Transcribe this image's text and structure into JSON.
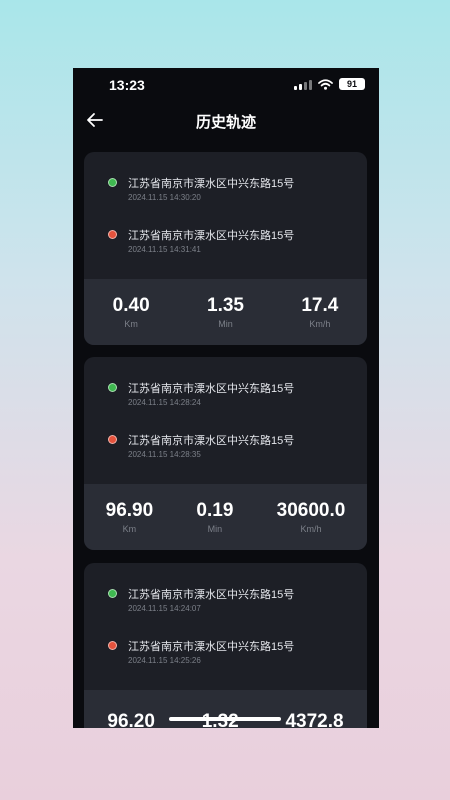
{
  "status_bar": {
    "time": "13:23",
    "battery": "91"
  },
  "header": {
    "title": "历史轨迹"
  },
  "icons": {
    "back": "arrow-left-icon",
    "signal": "cellular-signal-icon",
    "wifi": "wifi-icon",
    "battery": "battery-icon"
  },
  "colors": {
    "start_dot": "#3fb950",
    "end_dot": "#e5533d",
    "card_bg": "#1d1f26",
    "stats_bg": "#2a2d36"
  },
  "trips": [
    {
      "start": {
        "address": "江苏省南京市溧水区中兴东路15号",
        "time": "2024.11.15 14:30:20"
      },
      "end": {
        "address": "江苏省南京市溧水区中兴东路15号",
        "time": "2024.11.15 14:31:41"
      },
      "stats": [
        {
          "value": "0.40",
          "unit": "Km"
        },
        {
          "value": "1.35",
          "unit": "Min"
        },
        {
          "value": "17.4",
          "unit": "Km/h"
        }
      ]
    },
    {
      "start": {
        "address": "江苏省南京市溧水区中兴东路15号",
        "time": "2024.11.15 14:28:24"
      },
      "end": {
        "address": "江苏省南京市溧水区中兴东路15号",
        "time": "2024.11.15 14:28:35"
      },
      "stats": [
        {
          "value": "96.90",
          "unit": "Km"
        },
        {
          "value": "0.19",
          "unit": "Min"
        },
        {
          "value": "30600.0",
          "unit": "Km/h"
        }
      ]
    },
    {
      "start": {
        "address": "江苏省南京市溧水区中兴东路15号",
        "time": "2024.11.15 14:24:07"
      },
      "end": {
        "address": "江苏省南京市溧水区中兴东路15号",
        "time": "2024.11.15 14:25:26"
      },
      "stats": [
        {
          "value": "96.20",
          "unit": ""
        },
        {
          "value": "1.32",
          "unit": ""
        },
        {
          "value": "4372.8",
          "unit": ""
        }
      ]
    }
  ]
}
